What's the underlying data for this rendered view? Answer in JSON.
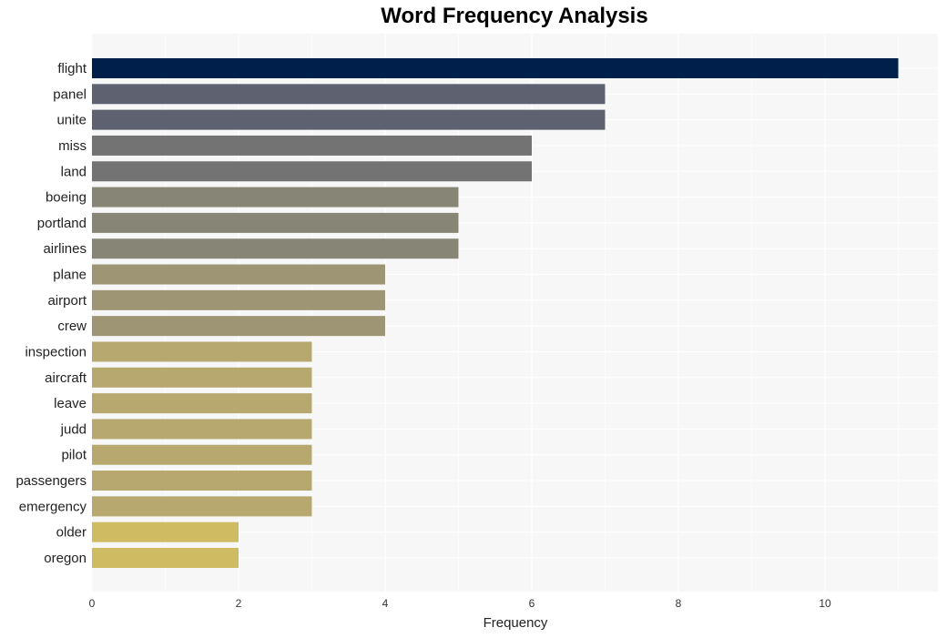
{
  "chart_data": {
    "type": "bar",
    "orientation": "horizontal",
    "title": "Word Frequency Analysis",
    "xlabel": "Frequency",
    "ylabel": "",
    "xlim": [
      0,
      11.5
    ],
    "xticks": [
      0,
      2,
      4,
      6,
      8,
      10
    ],
    "grid": true,
    "legend": "none",
    "categories": [
      "flight",
      "panel",
      "unite",
      "miss",
      "land",
      "boeing",
      "portland",
      "airlines",
      "plane",
      "airport",
      "crew",
      "inspection",
      "aircraft",
      "leave",
      "judd",
      "pilot",
      "passengers",
      "emergency",
      "older",
      "oregon"
    ],
    "values": [
      11,
      7,
      7,
      6,
      6,
      5,
      5,
      5,
      4,
      4,
      4,
      3,
      3,
      3,
      3,
      3,
      3,
      3,
      2,
      2
    ],
    "colors": [
      "#00204c",
      "#5e6270",
      "#5e6270",
      "#737373",
      "#737373",
      "#878576",
      "#878576",
      "#878576",
      "#9e9575",
      "#9e9575",
      "#9e9575",
      "#b6a86e",
      "#b6a86e",
      "#b6a86e",
      "#b6a86e",
      "#b6a86e",
      "#b6a86e",
      "#b6a86e",
      "#cfbc62",
      "#cfbc62"
    ]
  }
}
